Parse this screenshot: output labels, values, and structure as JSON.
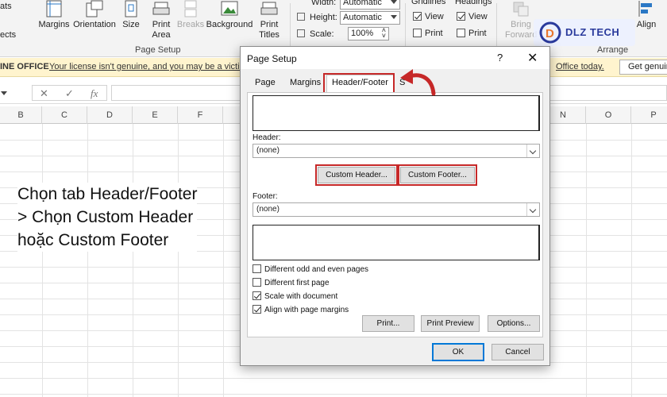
{
  "ribbon": {
    "left_labels": [
      "ats",
      "ects"
    ],
    "page_setup_buttons": [
      {
        "label": "Margins",
        "icon": "margins-icon"
      },
      {
        "label": "Orientation",
        "icon": "orientation-icon"
      },
      {
        "label": "Size",
        "icon": "size-icon"
      },
      {
        "label": "Print\nArea",
        "label_line1": "Print",
        "label_line2": "Area",
        "icon": "print-area-icon"
      },
      {
        "label": "Breaks",
        "icon": "breaks-icon",
        "disabled": true
      },
      {
        "label": "Background",
        "icon": "background-icon"
      },
      {
        "label": "Print\nTitles",
        "label_line1": "Print",
        "label_line2": "Titles",
        "icon": "print-titles-icon"
      }
    ],
    "page_setup_group_label": "Page Setup",
    "scale_to_fit": {
      "width_label": "Width:",
      "width_value": "Automatic",
      "height_label": "Height:",
      "height_value": "Automatic",
      "scale_label": "Scale:",
      "scale_value": "100%"
    },
    "sheet_options": {
      "gridlines_label": "Gridlines",
      "headings_label": "Headings",
      "view_label": "View",
      "print_label": "Print"
    },
    "arrange": {
      "bring_forward_line1": "Bring",
      "bring_forward_line2": "Forward",
      "align_label": "Align",
      "group_label": "Arrange"
    }
  },
  "license_bar": {
    "title": "INE OFFICE",
    "message": "Your license isn't genuine, and you may be a victim",
    "message_end": "Office today.",
    "button": "Get genuine"
  },
  "formula_bar": {
    "cancel_icon": "close-icon",
    "enter_icon": "check-icon",
    "fx_label": "fx"
  },
  "columns": [
    "B",
    "C",
    "D",
    "E",
    "F",
    "N",
    "O",
    "P"
  ],
  "annotation": {
    "line1": "Chọn tab Header/Footer",
    "line2": "> Chọn Custom Header",
    "line3": "hoặc Custom Footer"
  },
  "dialog": {
    "title": "Page Setup",
    "help": "?",
    "tabs": [
      "Page",
      "Margins",
      "Header/Footer",
      "Sheet"
    ],
    "active_tab": "Header/Footer",
    "header_label": "Header:",
    "header_value": "(none)",
    "custom_header_button": "Custom Header...",
    "custom_footer_button": "Custom Footer...",
    "footer_label": "Footer:",
    "footer_value": "(none)",
    "checkboxes": [
      {
        "label": "Different odd and even pages",
        "checked": false
      },
      {
        "label": "Different first page",
        "checked": false
      },
      {
        "label": "Scale with document",
        "checked": true
      },
      {
        "label": "Align with page margins",
        "checked": true
      }
    ],
    "print_button": "Print...",
    "print_preview_button": "Print Preview",
    "options_button": "Options...",
    "ok_button": "OK",
    "cancel_button": "Cancel"
  },
  "watermark": {
    "text": "DLZ TECH"
  },
  "colors": {
    "highlight": "#c62828",
    "license_bar": "#fff4ce",
    "watermark_text": "#2a3a9c"
  }
}
